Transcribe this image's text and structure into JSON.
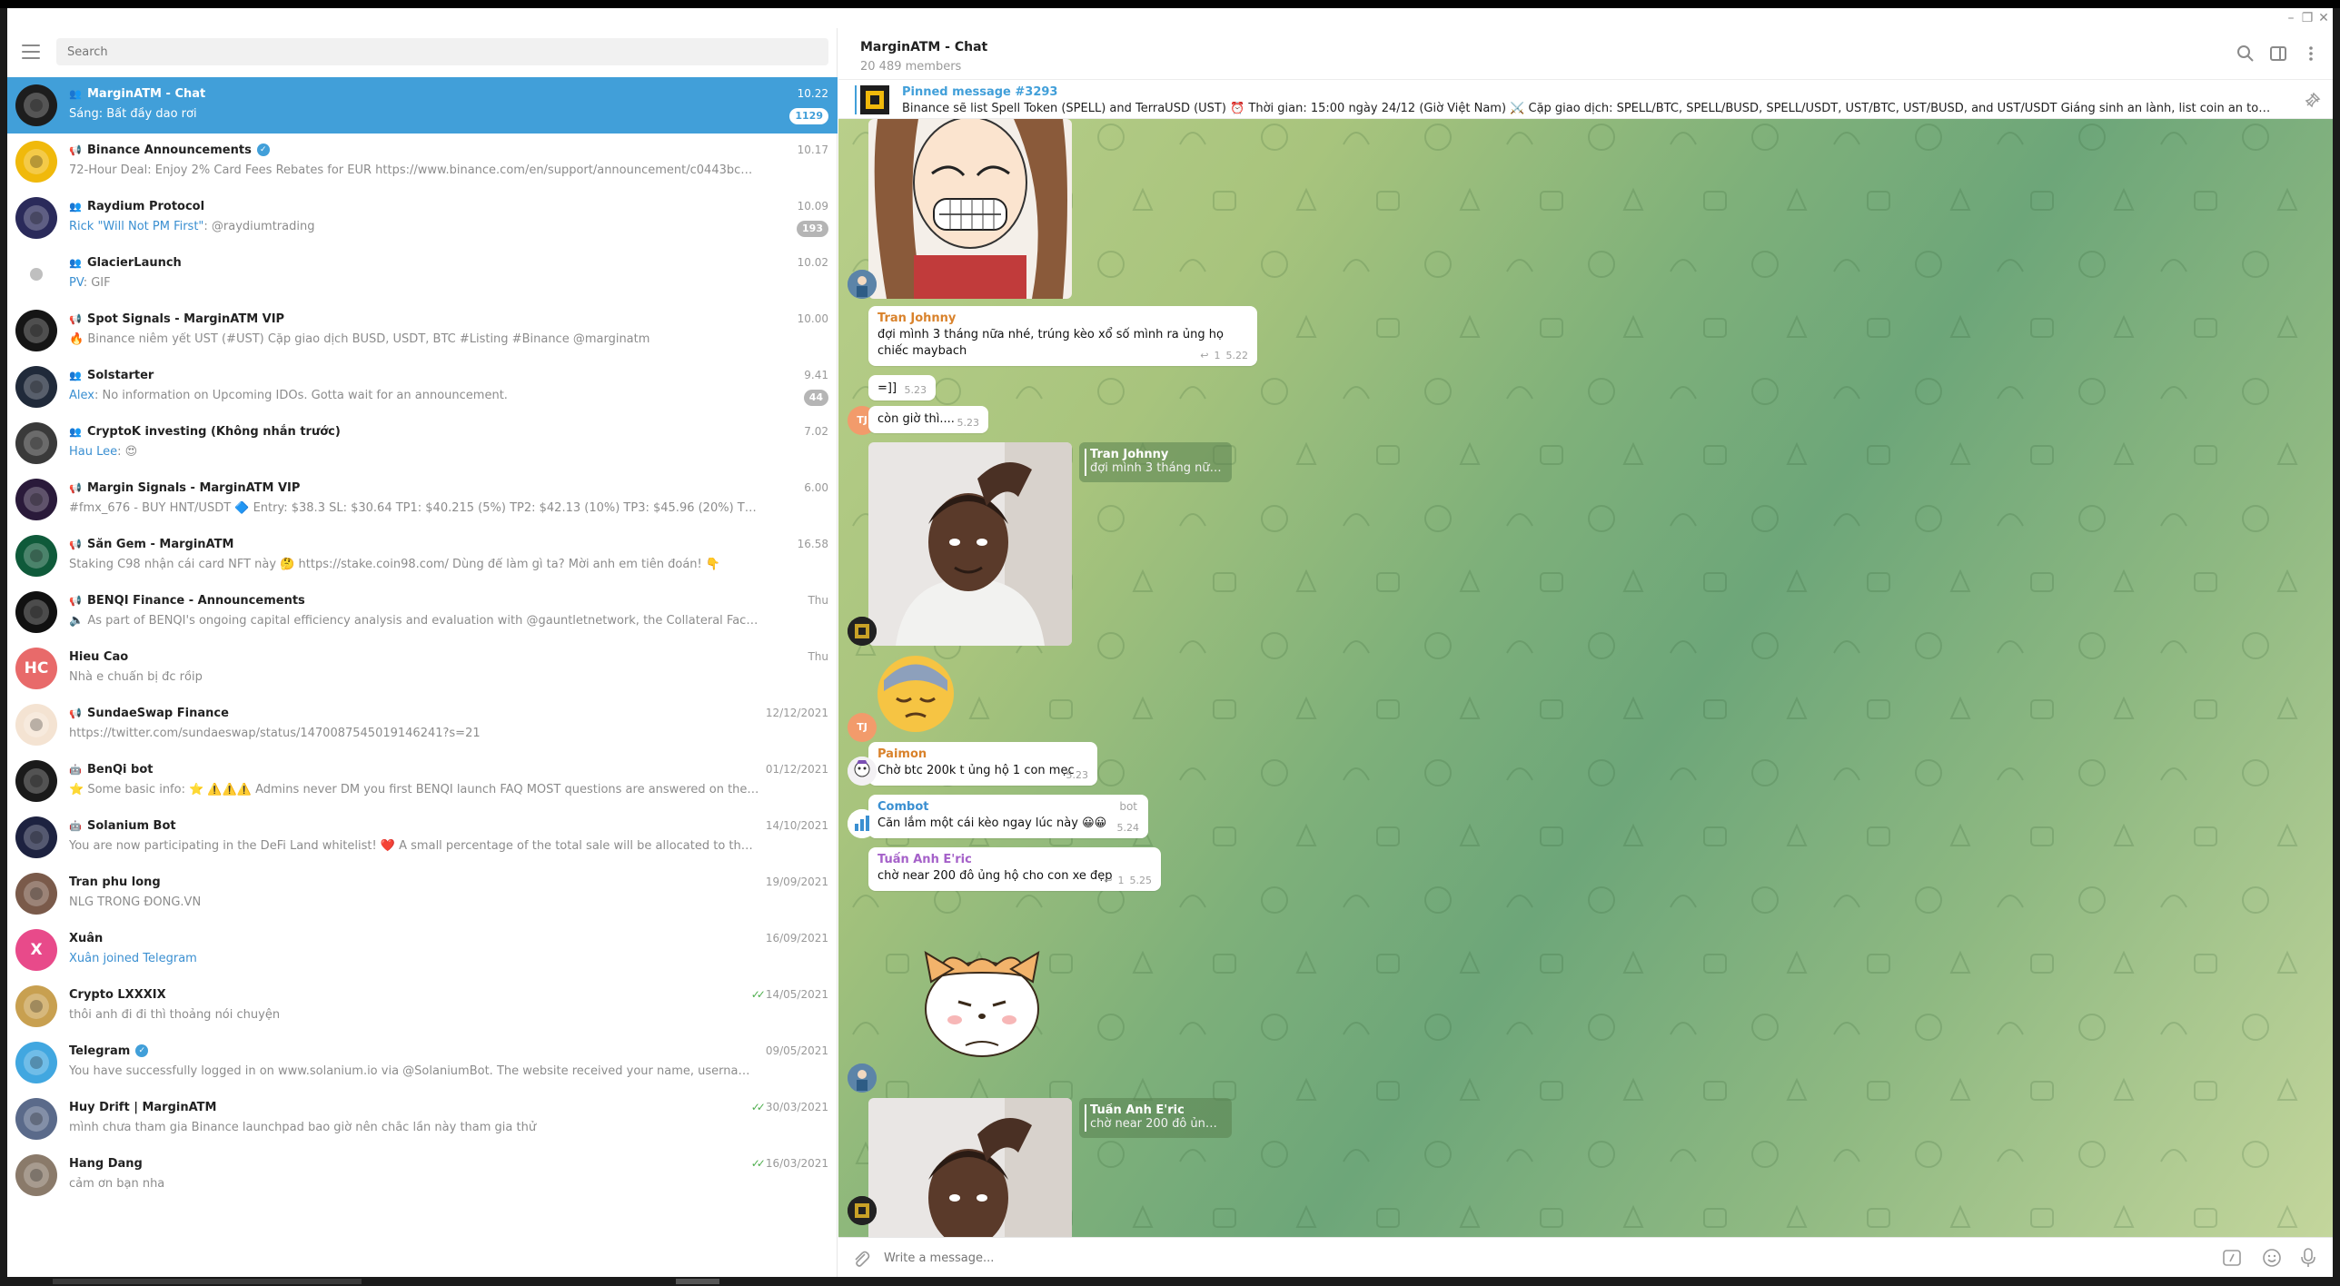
{
  "search": {
    "placeholder": "Search"
  },
  "chats": [
    {
      "title": "MarginATM - Chat",
      "kind": "group",
      "time": "10.22",
      "sender": "",
      "preview": "Sáng: Bất đầy dao rơi",
      "badge": "1129",
      "active": true
    },
    {
      "title": "Binance Announcements",
      "kind": "channel",
      "verified": true,
      "time": "10.17",
      "sender": "",
      "preview": "72-Hour Deal: Enjoy 2% Card Fees Rebates for EUR  https://www.binance.com/en/support/announcement/c0443bc5eb974157afb4fec28...",
      "badge": ""
    },
    {
      "title": "Raydium Protocol",
      "kind": "group",
      "time": "10.09",
      "sender": "Rick \"Will Not PM First\"",
      "preview": ": @raydiumtrading",
      "badge": "193"
    },
    {
      "title": "GlacierLaunch",
      "kind": "group",
      "time": "10.02",
      "sender": "PV",
      "preview": ": GIF",
      "badge": ""
    },
    {
      "title": "Spot Signals - MarginATM VIP",
      "kind": "channel",
      "time": "10.00",
      "sender": "",
      "preview": "🔥 Binance niêm yết UST (#UST) Cặp giao dịch BUSD, USDT, BTC  #Listing #Binance @marginatm",
      "badge": ""
    },
    {
      "title": "Solstarter",
      "kind": "group",
      "time": "9.41",
      "sender": "Alex",
      "preview": ": No information on Upcoming IDOs. Gotta wait for an announcement.",
      "badge": "44"
    },
    {
      "title": "CryptoK investing (Không nhắn trước)",
      "kind": "group",
      "time": "7.02",
      "sender": "Hau Lee",
      "preview": ": 😍",
      "badge": ""
    },
    {
      "title": "Margin Signals - MarginATM VIP",
      "kind": "channel",
      "time": "6.00",
      "sender": "",
      "preview": "#fmx_676 - BUY HNT/USDT 🔷  Entry: $38.3 SL: $30.64  TP1: $40.215 (5%) TP2: $42.13 (10%) TP3: $45.96 (20%) TP4: $49.79 (30%) TP5: $57.45 (5...",
      "badge": ""
    },
    {
      "title": "Săn Gem - MarginATM",
      "kind": "channel",
      "time": "16.58",
      "sender": "",
      "preview": "Staking C98 nhận cái card NFT này 🤔  https://stake.coin98.com/  Dùng để làm gì ta? Mời anh em tiên đoán! 👇",
      "badge": ""
    },
    {
      "title": "BENQI Finance - Announcements",
      "kind": "channel",
      "time": "Thu",
      "sender": "",
      "preview": "🔈 As part of BENQI's ongoing capital efficiency analysis and evaluation with @gauntletnetwork, the Collateral Factor (CF) for $QI will be...",
      "badge": ""
    },
    {
      "title": "Hieu Cao",
      "kind": "user",
      "time": "Thu",
      "sender": "",
      "preview": "Nhà e chuẩn bị đc rồip",
      "badge": "",
      "initials": "HC"
    },
    {
      "title": "SundaeSwap Finance",
      "kind": "channel",
      "time": "12/12/2021",
      "sender": "",
      "preview": "https://twitter.com/sundaeswap/status/1470087545019146241?s=21",
      "badge": ""
    },
    {
      "title": "BenQi bot",
      "kind": "bot",
      "time": "01/12/2021",
      "sender": "",
      "preview": "⭐ Some basic info: ⭐  ⚠️⚠️⚠️ Admins never DM you first  BENQI launch FAQ  MOST questions are answered on the official BENQI and ...",
      "badge": ""
    },
    {
      "title": "Solanium Bot",
      "kind": "bot",
      "time": "14/10/2021",
      "sender": "",
      "preview": "You are now participating in the DeFi Land whitelist! ❤️  A small percentage of the total sale will be allocated to the Social Pool. You can ear...",
      "badge": ""
    },
    {
      "title": "Tran phu long",
      "kind": "user",
      "time": "19/09/2021",
      "sender": "",
      "preview": "NLG TRỐNG ĐỒNG.VN",
      "badge": ""
    },
    {
      "title": "Xuân",
      "kind": "user",
      "time": "16/09/2021",
      "sender": "",
      "preview": "Xuân joined Telegram",
      "preview_accent": true,
      "badge": "",
      "initials": "X"
    },
    {
      "title": "Crypto LXXXIX",
      "kind": "user",
      "time": "14/05/2021",
      "read": true,
      "sender": "",
      "preview": "thôi anh đi đi thì thoảng nói chuyện",
      "badge": ""
    },
    {
      "title": "Telegram",
      "kind": "user",
      "verified": true,
      "time": "09/05/2021",
      "sender": "",
      "preview": "You have successfully logged in on www.solanium.io via @SolaniumBot. The website received your name, username and profile picture. @S...",
      "badge": ""
    },
    {
      "title": "Huy Drift | MarginATM",
      "kind": "user",
      "time": "30/03/2021",
      "read": true,
      "sender": "",
      "preview": "mình chưa tham gia Binance launchpad bao giờ nên chắc lần này tham gia thử",
      "badge": ""
    },
    {
      "title": "Hang Dang",
      "kind": "user",
      "time": "16/03/2021",
      "read": true,
      "sender": "",
      "preview": "cảm ơn bạn nha",
      "badge": ""
    }
  ],
  "header": {
    "title": "MarginATM - Chat",
    "members": "20 489 members"
  },
  "pinned": {
    "title": "Pinned message #3293",
    "text": "Binance sẽ list Spell Token (SPELL) and TerraUSD (UST) ⏰ Thời gian: 15:00 ngày 24/12 (Giờ Việt Nam) ⚔️ Cặp giao dịch: SPELL/BTC, SPELL/BUSD, SPELL/USDT, UST/BTC, UST/BUSD, and UST/USDT  Giáng sinh an lành, list coin an toàn nhưng list nhiều quá hiệ..."
  },
  "messages": {
    "m1": {
      "sender": "Tran Johnny",
      "text": "đợi mình 3 tháng nữa nhé, trúng kèo xổ số mình ra ủng họ chiếc maybach",
      "replies": "1",
      "time": "5.22"
    },
    "m2": {
      "text": "=]]",
      "time": "5.23"
    },
    "m3": {
      "text": "còn giờ thì....",
      "time": "5.23",
      "initials": "TJ"
    },
    "m4_reply": {
      "name": "Tran Johnny",
      "text": "đợi mình 3 tháng nữa ..."
    },
    "m5": {
      "initials": "TJ"
    },
    "m6": {
      "sender": "Paimon",
      "text": "Chờ btc 200k t ủng hộ 1 con mẹc",
      "time": "5.23"
    },
    "m7": {
      "sender": "Combot",
      "tag": "bot",
      "text": "Căn lắm một cái kèo ngay lúc này 😀😀",
      "time": "5.24"
    },
    "m8": {
      "sender": "Tuấn Anh E'ric",
      "text": "chờ near 200 đô ủng hộ cho con xe đẹp",
      "replies": "1",
      "time": "5.25"
    },
    "m9_reply": {
      "name": "Tuấn Anh E'ric",
      "text": "chờ near 200 đô ủng h..."
    }
  },
  "scroll": {
    "unread": "1129"
  },
  "composer": {
    "placeholder": "Write a message..."
  },
  "colors": {
    "accent": "#419fd9",
    "tran_johnny": "#d9822b",
    "paimon": "#d9822b",
    "combot": "#3a8fd1",
    "tuan_anh": "#a561c9"
  }
}
